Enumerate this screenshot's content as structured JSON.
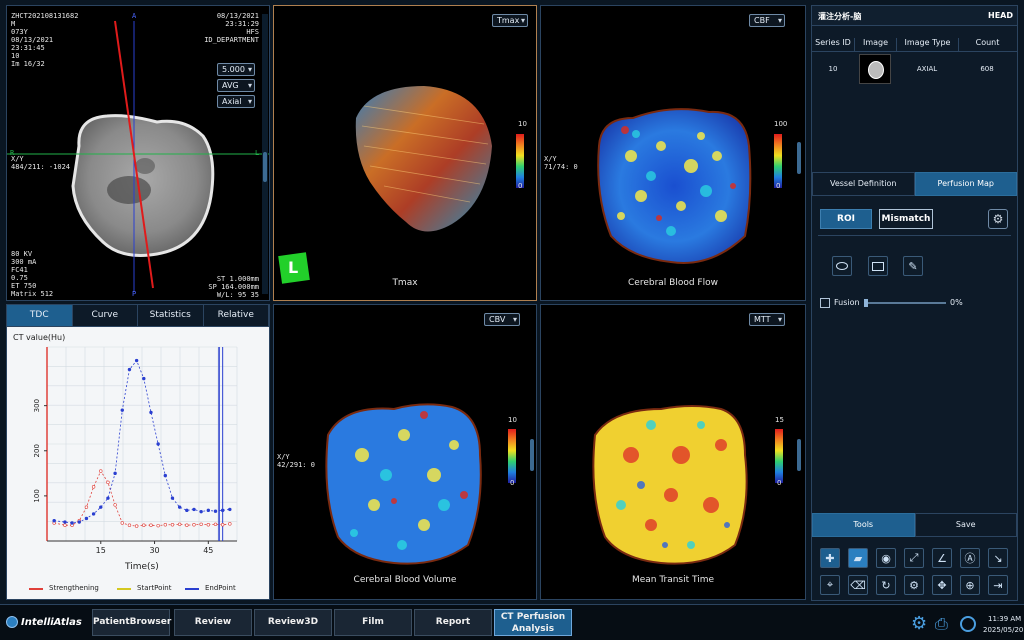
{
  "viewport_tl": {
    "patient_id": "ZHCT202108131682",
    "sex": "M",
    "age": "073Y",
    "study_date": "08/13/2021",
    "study_time": "23:31:45",
    "series": "10",
    "image": "Im 16/32",
    "date_right": "08/13/2021",
    "time_right": "23:31:29",
    "position": "HFS",
    "department": "ID_DEPARTMENT",
    "thickness": "5.000",
    "mode": "AVG",
    "orientation": "Axial",
    "xy_label": "X/Y",
    "xy_value": "484/211: -1024",
    "kv": "80 KV",
    "ma": "300 mA",
    "fc": "FC41",
    "val": "0.75",
    "et": "ET 750",
    "matrix": "Matrix 512",
    "st": "ST 1.000mm",
    "sp": "SP 164.000mm",
    "wl": "W/L: 95 35",
    "marker_a": "A",
    "marker_p": "P",
    "marker_r": "R",
    "marker_l": "L"
  },
  "viewport_tmax": {
    "dropdown": "Tmax",
    "caption": "Tmax",
    "scale_max": "10",
    "scale_min": "0",
    "orient": "L"
  },
  "viewport_cbf": {
    "dropdown": "CBF",
    "caption": "Cerebral Blood Flow",
    "scale_max": "100",
    "scale_min": "0",
    "xy_label": "X/Y",
    "xy_value": "71/74: 0"
  },
  "viewport_cbv": {
    "dropdown": "CBV",
    "caption": "Cerebral Blood Volume",
    "scale_max": "10",
    "scale_min": "0",
    "xy_label": "X/Y",
    "xy_value": "42/291: 0"
  },
  "viewport_mtt": {
    "dropdown": "MTT",
    "caption": "Mean Transit Time",
    "scale_max": "15",
    "scale_min": "0"
  },
  "tdc_panel": {
    "tabs": [
      "TDC",
      "Curve",
      "Statistics",
      "Relative"
    ],
    "y_title": "CT value(Hu)",
    "x_title": "Time(s)",
    "legend": [
      "Strengthening",
      "StartPoint",
      "EndPoint"
    ]
  },
  "chart_data": {
    "type": "line",
    "title": "",
    "xlabel": "Time(s)",
    "ylabel": "CT value(Hu)",
    "x_ticks": [
      "15",
      "30",
      "45"
    ],
    "y_ticks": [
      "100",
      "200",
      "300"
    ],
    "xlim": [
      0,
      53
    ],
    "ylim": [
      0,
      430
    ],
    "series": [
      {
        "name": "Strengthening",
        "color": "#e0403a",
        "x": [
          2,
          5,
          7,
          9,
          11,
          13,
          15,
          17,
          19,
          21,
          23,
          25,
          27,
          29,
          31,
          33,
          35,
          37,
          39,
          41,
          43,
          45,
          47,
          49,
          51
        ],
        "y": [
          40,
          35,
          35,
          45,
          75,
          120,
          155,
          130,
          80,
          40,
          35,
          33,
          35,
          35,
          34,
          36,
          36,
          37,
          35,
          36,
          37,
          36,
          37,
          36,
          38
        ]
      },
      {
        "name": "EndPoint",
        "color": "#2a3fd0",
        "x": [
          2,
          5,
          7,
          9,
          11,
          13,
          15,
          17,
          19,
          21,
          23,
          25,
          27,
          29,
          31,
          33,
          35,
          37,
          39,
          41,
          43,
          45,
          47,
          49,
          51
        ],
        "y": [
          45,
          42,
          40,
          42,
          50,
          60,
          75,
          95,
          150,
          290,
          380,
          400,
          360,
          285,
          215,
          145,
          95,
          75,
          68,
          70,
          65,
          68,
          66,
          68,
          70
        ]
      }
    ]
  },
  "right_panel": {
    "title": "灌注分析-脑",
    "region": "HEAD",
    "table_headers": [
      "Series ID",
      "Image",
      "Image Type",
      "Count"
    ],
    "table_rows": [
      {
        "series_id": "10",
        "image_type": "AXIAL",
        "count": "608"
      }
    ],
    "tabs": [
      "Vessel Definition",
      "Perfusion Map"
    ],
    "roi_label": "ROI",
    "mismatch_label": "Mismatch",
    "fusion_label": "Fusion",
    "fusion_value": "0%",
    "fusion_percent": 0,
    "tools_label": "Tools",
    "save_label": "Save"
  },
  "bottom_bar": {
    "logo": "IntelliAtlas",
    "nav": [
      "PatientBrowser",
      "Review",
      "Review3D",
      "Film",
      "Report",
      "CT Perfusion Analysis"
    ],
    "active": "CT Perfusion Analysis",
    "time": "11:39 AM",
    "date": "2025/05/20"
  }
}
